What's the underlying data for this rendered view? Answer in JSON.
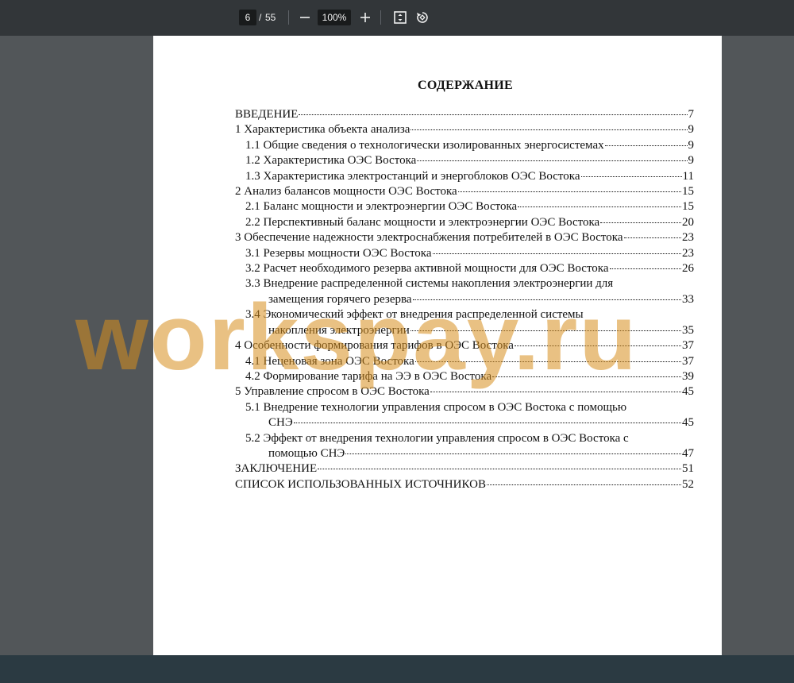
{
  "toolbar": {
    "page_current": "6",
    "page_separator": "/",
    "page_total": "55",
    "zoom": "100%"
  },
  "document": {
    "title": "СОДЕРЖАНИЕ",
    "toc": [
      {
        "level": 1,
        "lines": [
          "ВВЕДЕНИЕ"
        ],
        "page": "7"
      },
      {
        "level": 1,
        "lines": [
          "1 Характеристика объекта анализа"
        ],
        "page": "9"
      },
      {
        "level": 2,
        "lines": [
          "1.1 Общие сведения о технологически изолированных энергосистемах"
        ],
        "page": "9"
      },
      {
        "level": 2,
        "lines": [
          "1.2 Характеристика ОЭС Востока"
        ],
        "page": "9"
      },
      {
        "level": 2,
        "lines": [
          "1.3 Характеристика электростанций и энергоблоков ОЭС Востока"
        ],
        "page": "11"
      },
      {
        "level": 1,
        "lines": [
          "2 Анализ балансов мощности ОЭС Востока"
        ],
        "page": "15"
      },
      {
        "level": 2,
        "lines": [
          "2.1 Баланс мощности и электроэнергии ОЭС Востока"
        ],
        "page": "15"
      },
      {
        "level": 2,
        "lines": [
          "2.2 Перспективный баланс мощности и электроэнергии ОЭС Востока"
        ],
        "page": "20"
      },
      {
        "level": 1,
        "lines": [
          "3 Обеспечение надежности электроснабжения потребителей в ОЭС Востока"
        ],
        "page": "23"
      },
      {
        "level": 2,
        "lines": [
          "3.1 Резервы мощности ОЭС Востока"
        ],
        "page": "23"
      },
      {
        "level": 2,
        "lines": [
          "3.2 Расчет необходимого резерва активной мощности для ОЭС Востока"
        ],
        "page": "26"
      },
      {
        "level": 2,
        "lines": [
          "3.3 Внедрение распределенной системы накопления электроэнергии для",
          "замещения горячего резерва"
        ],
        "page": "33"
      },
      {
        "level": 2,
        "lines": [
          "3.4 Экономический эффект от внедрения распределенной системы",
          "накопления электроэнергии"
        ],
        "page": "35"
      },
      {
        "level": 1,
        "lines": [
          "4 Особенности формирования тарифов в ОЭС Востока"
        ],
        "page": "37"
      },
      {
        "level": 2,
        "lines": [
          "4.1 Нецeновая зона ОЭС Востока"
        ],
        "page": "37"
      },
      {
        "level": 2,
        "lines": [
          "4.2 Формирование тарифа на ЭЭ в ОЭС Востока"
        ],
        "page": "39"
      },
      {
        "level": 1,
        "lines": [
          "5 Управление спросом в ОЭС Востока"
        ],
        "page": "45"
      },
      {
        "level": 2,
        "lines": [
          "5.1 Внедрение технологии управления спросом в ОЭС Востока с помощью",
          "СНЭ"
        ],
        "page": "45"
      },
      {
        "level": 2,
        "lines": [
          "5.2 Эффект от внедрения технологии управления спросом в ОЭС Востока с",
          "помощью СНЭ"
        ],
        "page": "47"
      },
      {
        "level": 1,
        "lines": [
          "ЗАКЛЮЧЕНИЕ"
        ],
        "page": "51"
      },
      {
        "level": 1,
        "lines": [
          "СПИСОК ИСПОЛЬЗОВАННЫХ ИСТОЧНИКОВ"
        ],
        "page": "52"
      }
    ]
  },
  "watermark": "workspay.ru",
  "icons": {
    "zoom_out": "minus-icon",
    "zoom_in": "plus-icon",
    "fit": "fit-page-icon",
    "rotate": "rotate-icon"
  }
}
